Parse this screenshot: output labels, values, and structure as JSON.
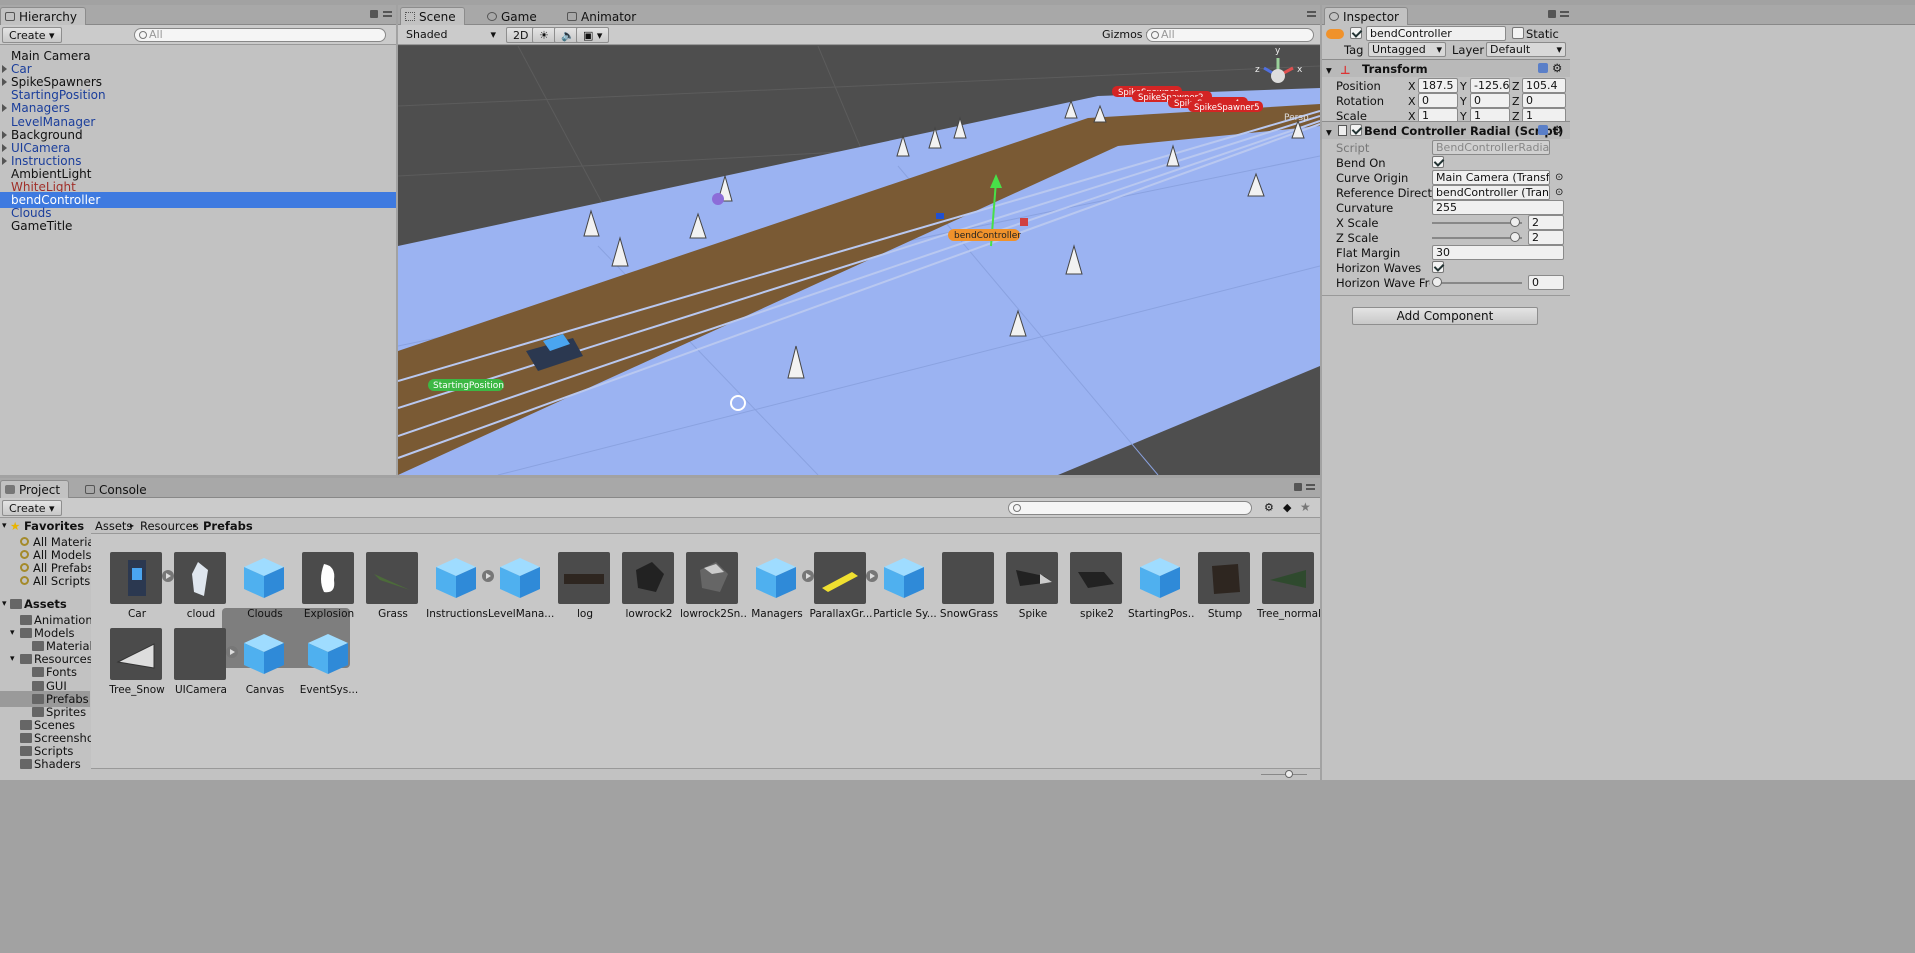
{
  "hierarchy": {
    "tab": "Hierarchy",
    "create": "Create",
    "search_placeholder": "All",
    "items": [
      {
        "label": "Main Camera",
        "type": "normal",
        "fold": false
      },
      {
        "label": "Car",
        "type": "prefab",
        "fold": true
      },
      {
        "label": "SpikeSpawners",
        "type": "normal",
        "fold": true
      },
      {
        "label": "StartingPosition",
        "type": "prefab",
        "fold": false
      },
      {
        "label": "Managers",
        "type": "prefab",
        "fold": true
      },
      {
        "label": "LevelManager",
        "type": "prefab",
        "fold": false
      },
      {
        "label": "Background",
        "type": "normal",
        "fold": true
      },
      {
        "label": "UICamera",
        "type": "prefab",
        "fold": true
      },
      {
        "label": "Instructions",
        "type": "prefab",
        "fold": true
      },
      {
        "label": "AmbientLight",
        "type": "normal",
        "fold": false
      },
      {
        "label": "WhiteLight",
        "type": "broken",
        "fold": false
      },
      {
        "label": "bendController",
        "type": "selected",
        "fold": false
      },
      {
        "label": "Clouds",
        "type": "prefab",
        "fold": false
      },
      {
        "label": "GameTitle",
        "type": "normal",
        "fold": false
      }
    ]
  },
  "scene": {
    "tabs": [
      "Scene",
      "Game",
      "Animator"
    ],
    "shading": "Shaded",
    "mode_2d": "2D",
    "gizmos": "Gizmos",
    "search_placeholder": "All",
    "labels": {
      "starting": "StartingPosition",
      "bend": "bendController",
      "spawner1": "SpikeSpawner",
      "spawner2": "SpikeSpawner2",
      "spawner3": "SpikeSpawner4",
      "spawner5": "SpikeSpawner5",
      "persp": "Persp"
    },
    "gizmo_axes": {
      "y": "y",
      "x": "x",
      "z": "z"
    }
  },
  "inspector": {
    "tab": "Inspector",
    "object_name": "bendController",
    "static_label": "Static",
    "tag_label": "Tag",
    "tag_value": "Untagged",
    "layer_label": "Layer",
    "layer_value": "Default",
    "transform": {
      "title": "Transform",
      "position_label": "Position",
      "rotation_label": "Rotation",
      "scale_label": "Scale",
      "position": {
        "x": "187.5",
        "y": "-125.6",
        "z": "105.4"
      },
      "rotation": {
        "x": "0",
        "y": "0",
        "z": "0"
      },
      "scale": {
        "x": "1",
        "y": "1",
        "z": "1"
      }
    },
    "script": {
      "title": "Bend Controller Radial (Script)",
      "script_label": "Script",
      "script_value": "BendControllerRadial",
      "bend_on_label": "Bend On",
      "bend_on": true,
      "curve_origin_label": "Curve Origin",
      "curve_origin_value": "Main Camera (Transfo",
      "ref_dir_label": "Reference Direction",
      "ref_dir_value": "bendController (Trans",
      "curvature_label": "Curvature",
      "curvature_value": "255",
      "xscale_label": "X Scale",
      "xscale_value": "2",
      "xscale_fraction": 0.97,
      "zscale_label": "Z Scale",
      "zscale_value": "2",
      "zscale_fraction": 0.97,
      "flat_margin_label": "Flat Margin",
      "flat_margin_value": "30",
      "horizon_waves_label": "Horizon Waves",
      "horizon_waves": true,
      "horizon_freq_label": "Horizon Wave Freque",
      "horizon_freq_value": "0",
      "horizon_freq_fraction": 0.0
    },
    "add_component": "Add Component"
  },
  "project": {
    "tabs": [
      "Project",
      "Console"
    ],
    "create": "Create",
    "breadcrumb": [
      "Assets",
      "Resources",
      "Prefabs"
    ],
    "favorites_label": "Favorites",
    "favorites": [
      "All Materials",
      "All Models",
      "All Prefabs",
      "All Scripts"
    ],
    "assets_label": "Assets",
    "tree": [
      {
        "label": "Animations",
        "depth": 1
      },
      {
        "label": "Models",
        "depth": 1
      },
      {
        "label": "Materials",
        "depth": 2
      },
      {
        "label": "Resources",
        "depth": 1
      },
      {
        "label": "Fonts",
        "depth": 2
      },
      {
        "label": "GUI",
        "depth": 2
      },
      {
        "label": "Prefabs",
        "depth": 2,
        "selected": true
      },
      {
        "label": "Sprites",
        "depth": 2
      },
      {
        "label": "Scenes",
        "depth": 1
      },
      {
        "label": "Screenshots",
        "depth": 1
      },
      {
        "label": "Scripts",
        "depth": 1
      },
      {
        "label": "Shaders",
        "depth": 1
      }
    ],
    "assets": [
      {
        "name": "Car",
        "kind": "car",
        "arrow": true
      },
      {
        "name": "cloud",
        "kind": "cloud"
      },
      {
        "name": "Clouds",
        "kind": "cube"
      },
      {
        "name": "Explosion",
        "kind": "explosion"
      },
      {
        "name": "Grass",
        "kind": "grass"
      },
      {
        "name": "Instructions",
        "kind": "cube",
        "arrow": true
      },
      {
        "name": "LevelMana...",
        "kind": "cube"
      },
      {
        "name": "log",
        "kind": "log"
      },
      {
        "name": "lowrock2",
        "kind": "rock"
      },
      {
        "name": "lowrock2Sn...",
        "kind": "rocksnow"
      },
      {
        "name": "Managers",
        "kind": "cube",
        "arrow": true
      },
      {
        "name": "ParallaxGr...",
        "kind": "parallax",
        "arrow": true
      },
      {
        "name": "Particle Sy...",
        "kind": "cube"
      },
      {
        "name": "SnowGrass",
        "kind": "snowgrass"
      },
      {
        "name": "Spike",
        "kind": "spike"
      },
      {
        "name": "spike2",
        "kind": "spike2"
      },
      {
        "name": "StartingPos...",
        "kind": "cube"
      },
      {
        "name": "Stump",
        "kind": "stump"
      },
      {
        "name": "Tree_normal",
        "kind": "tree"
      },
      {
        "name": "Tree_Snow",
        "kind": "treesnow"
      },
      {
        "name": "UICamera",
        "kind": "empty",
        "arrow": true
      },
      {
        "name": "Canvas",
        "kind": "cube",
        "group": true
      },
      {
        "name": "EventSys...",
        "kind": "cube",
        "group": true
      }
    ]
  },
  "colors": {
    "selection": "#3e7ae0",
    "prefab_text": "#1b3e9b",
    "ground": "#9bb3f2",
    "road": "#7a5a34",
    "starting_label": "#3cb844",
    "bend_label": "#f0922b",
    "spawner_label": "#d42424"
  }
}
